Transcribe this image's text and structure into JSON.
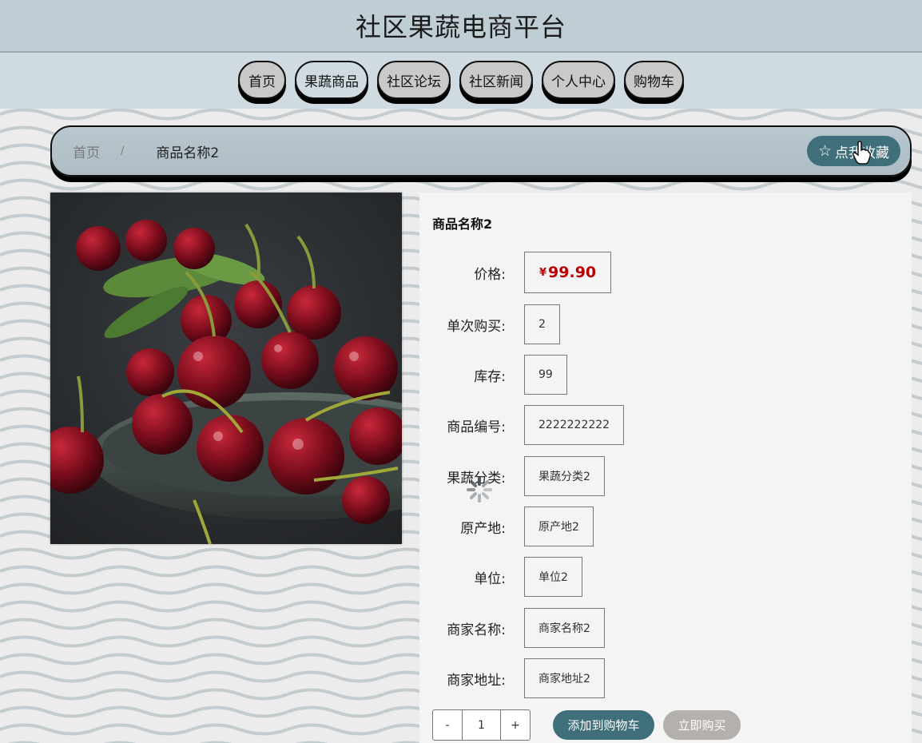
{
  "header": {
    "title": "社区果蔬电商平台"
  },
  "nav": {
    "items": [
      {
        "label": "首页",
        "active": false
      },
      {
        "label": "果蔬商品",
        "active": true
      },
      {
        "label": "社区论坛",
        "active": false
      },
      {
        "label": "社区新闻",
        "active": false
      },
      {
        "label": "个人中心",
        "active": false
      },
      {
        "label": "购物车",
        "active": false
      }
    ]
  },
  "breadcrumb": {
    "home": "首页",
    "separator": "/",
    "current": "商品名称2",
    "favorite_label": "点我收藏",
    "favorite_icon": "star-outline-icon"
  },
  "product": {
    "name": "商品名称2",
    "image_icon": "cherries-photo",
    "fields": [
      {
        "key": "price",
        "label": "价格:",
        "currency": "¥",
        "value": "99.90"
      },
      {
        "key": "single_purchase",
        "label": "单次购买:",
        "value": "2"
      },
      {
        "key": "stock",
        "label": "库存:",
        "value": "99"
      },
      {
        "key": "product_code",
        "label": "商品编号:",
        "value": "2222222222"
      },
      {
        "key": "category",
        "label": "果蔬分类:",
        "value": "果蔬分类2"
      },
      {
        "key": "origin",
        "label": "原产地:",
        "value": "原产地2"
      },
      {
        "key": "unit",
        "label": "单位:",
        "value": "单位2"
      },
      {
        "key": "merchant_name",
        "label": "商家名称:",
        "value": "商家名称2"
      },
      {
        "key": "merchant_address",
        "label": "商家地址:",
        "value": "商家地址2"
      }
    ]
  },
  "purchase": {
    "decrement": "-",
    "quantity": "1",
    "increment": "+",
    "add_to_cart": "添加到购物车",
    "buy_now": "立即购买"
  },
  "colors": {
    "accent": "#3f6f7a",
    "price": "#bb0000",
    "buy_button": "#b4b0ab",
    "header_bg": "#bfcdd4"
  }
}
